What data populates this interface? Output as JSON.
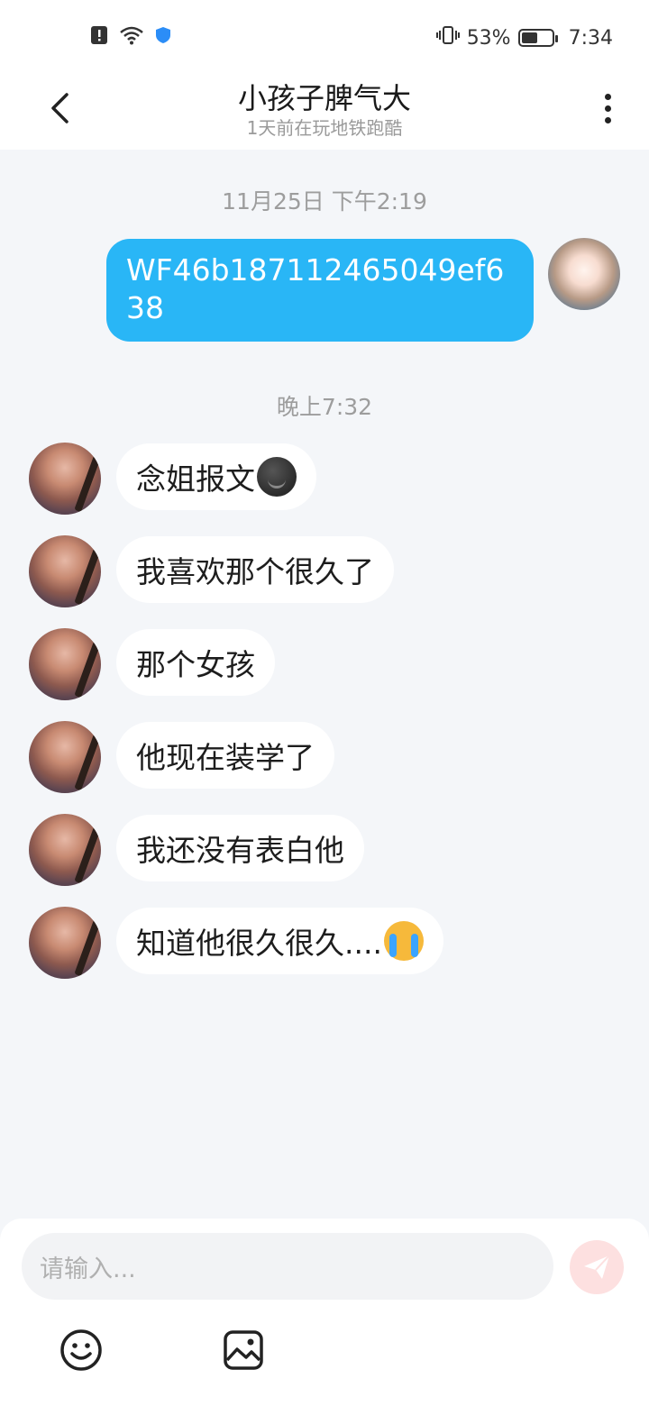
{
  "status": {
    "battery_percent": "53%",
    "battery_level": 0.53,
    "time": "7:34"
  },
  "header": {
    "title": "小孩子脾气大",
    "subtitle": "1天前在玩地铁跑酷"
  },
  "messages": {
    "timestamp_1": "11月25日 下午2:19",
    "outgoing_1": "WF46b187112465049ef638",
    "timestamp_2": "晚上7:32",
    "incoming": [
      {
        "text": "念姐报文",
        "emoji": "dark-smile-emoji"
      },
      {
        "text": "我喜欢那个很久了"
      },
      {
        "text": "那个女孩"
      },
      {
        "text": "他现在装学了"
      },
      {
        "text": "我还没有表白他"
      },
      {
        "text": "知道他很久很久....",
        "emoji": "crying-face-emoji"
      }
    ]
  },
  "composer": {
    "placeholder": "请输入..."
  },
  "colors": {
    "outgoing_bubble": "#29b6f6",
    "send_button": "#fde0e0",
    "background": "#f4f6f9"
  }
}
